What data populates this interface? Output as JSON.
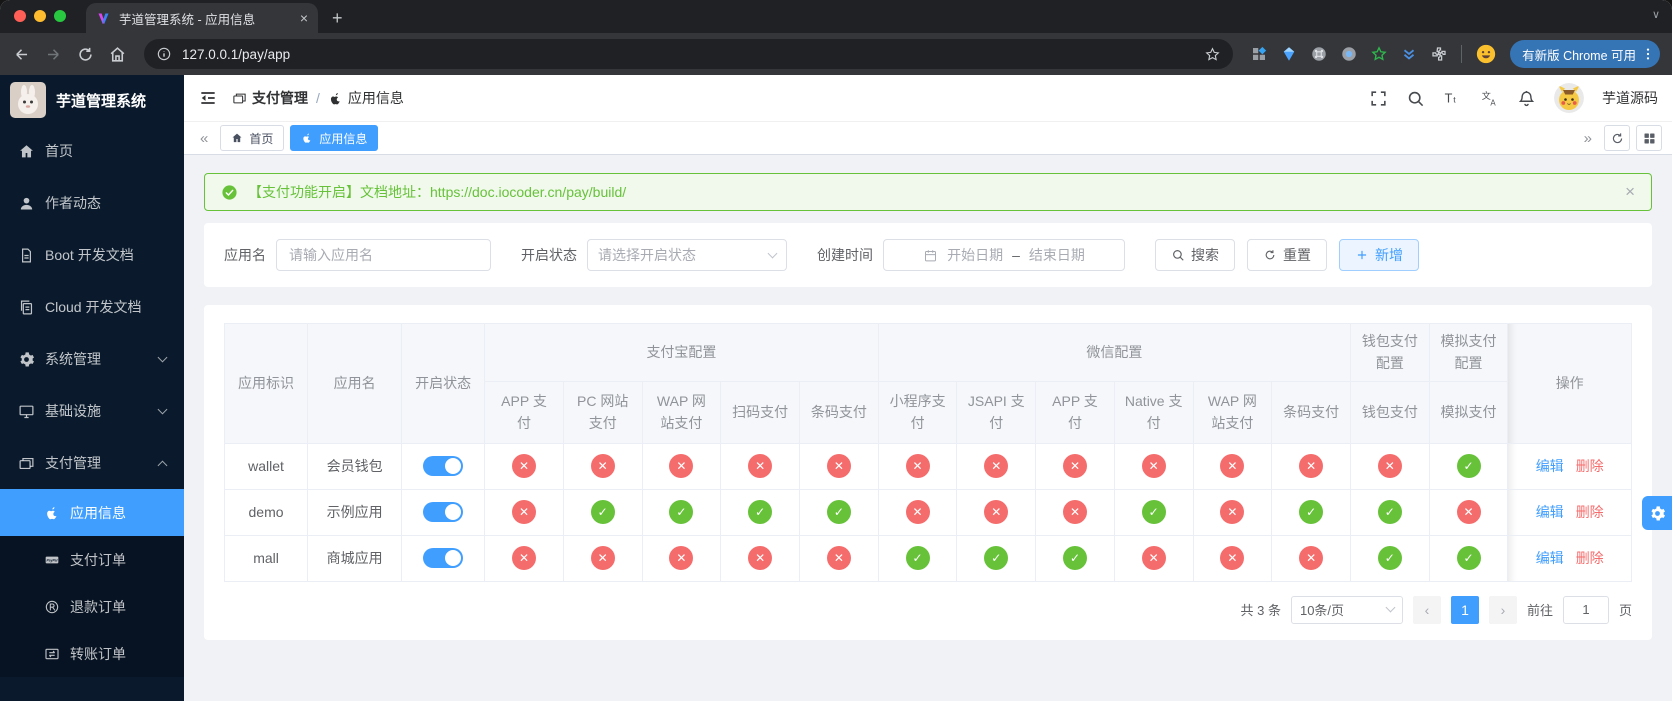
{
  "colors": {
    "accent": "#409eff",
    "success": "#67c23a",
    "danger": "#f56c6c",
    "sidebar_bg": "#0a1a2c"
  },
  "browser": {
    "tab_title": "芋道管理系统 - 应用信息",
    "url": "127.0.0.1/pay/app",
    "update_label": "有新版 Chrome 可用",
    "extensions": [
      "apps-extension-icon",
      "gem-extension-icon",
      "command-extension-icon",
      "recorder-extension-icon",
      "star-extension-icon",
      "chevrons-extension-icon",
      "puzzle-icon"
    ]
  },
  "sidebar": {
    "title": "芋道管理系统",
    "items": [
      {
        "label": "首页",
        "icon": "home-icon"
      },
      {
        "label": "作者动态",
        "icon": "user-icon"
      },
      {
        "label": "Boot 开发文档",
        "icon": "document-icon"
      },
      {
        "label": "Cloud 开发文档",
        "icon": "documents-icon"
      },
      {
        "label": "系统管理",
        "icon": "gear-icon",
        "arrow": "down"
      },
      {
        "label": "基础设施",
        "icon": "monitor-icon",
        "arrow": "down"
      },
      {
        "label": "支付管理",
        "icon": "payment-icon",
        "arrow": "up",
        "children": [
          {
            "label": "应用信息",
            "icon": "apple-icon",
            "active": true
          },
          {
            "label": "支付订单",
            "icon": "paypal-icon"
          },
          {
            "label": "退款订单",
            "icon": "refund-icon"
          },
          {
            "label": "转账订单",
            "icon": "transfer-icon"
          }
        ]
      }
    ]
  },
  "navbar": {
    "breadcrumb": [
      {
        "label": "支付管理",
        "icon": "payment-icon"
      },
      {
        "label": "应用信息",
        "icon": "apple-icon"
      }
    ],
    "separator": "/",
    "tools": [
      "fullscreen-icon",
      "search-icon",
      "font-size-icon",
      "language-icon",
      "bell-icon"
    ],
    "username": "芋道源码"
  },
  "tags": [
    {
      "label": "首页",
      "icon": "home-icon",
      "active": false
    },
    {
      "label": "应用信息",
      "icon": "apple-icon",
      "active": true
    }
  ],
  "alert": {
    "message": "【支付功能开启】文档地址：",
    "link": "https://doc.iocoder.cn/pay/build/"
  },
  "filters": {
    "name_label": "应用名",
    "name_placeholder": "请输入应用名",
    "status_label": "开启状态",
    "status_placeholder": "请选择开启状态",
    "date_label": "创建时间",
    "date_start": "开始日期",
    "date_separator": "–",
    "date_end": "结束日期",
    "search_label": "搜索",
    "reset_label": "重置",
    "add_label": "新增"
  },
  "table": {
    "fixed_columns": [
      "应用标识",
      "应用名",
      "开启状态"
    ],
    "groups": [
      {
        "label": "支付宝配置",
        "columns": [
          "APP 支付",
          "PC 网站支付",
          "WAP 网站支付",
          "扫码支付",
          "条码支付"
        ]
      },
      {
        "label": "微信配置",
        "columns": [
          "小程序支付",
          "JSAPI 支付",
          "APP 支付",
          "Native 支付",
          "WAP 网站支付",
          "条码支付"
        ]
      },
      {
        "label": "钱包支付配置",
        "columns": [
          "钱包支付"
        ]
      },
      {
        "label": "模拟支付配置",
        "columns": [
          "模拟支付"
        ]
      }
    ],
    "action_label": "操作",
    "edit_label": "编辑",
    "delete_label": "删除",
    "rows": [
      {
        "code": "wallet",
        "name": "会员钱包",
        "enabled": true,
        "statuses": [
          0,
          0,
          0,
          0,
          0,
          0,
          0,
          0,
          0,
          0,
          0,
          0,
          1
        ]
      },
      {
        "code": "demo",
        "name": "示例应用",
        "enabled": true,
        "statuses": [
          0,
          1,
          1,
          1,
          1,
          0,
          0,
          0,
          1,
          0,
          1,
          1,
          0
        ]
      },
      {
        "code": "mall",
        "name": "商城应用",
        "enabled": true,
        "statuses": [
          0,
          0,
          0,
          0,
          0,
          1,
          1,
          1,
          0,
          0,
          0,
          1,
          1
        ]
      }
    ]
  },
  "pagination": {
    "total": "共 3 条",
    "page_size": "10条/页",
    "current_page": "1",
    "goto_label": "前往",
    "goto_value": "1",
    "page_unit": "页"
  }
}
